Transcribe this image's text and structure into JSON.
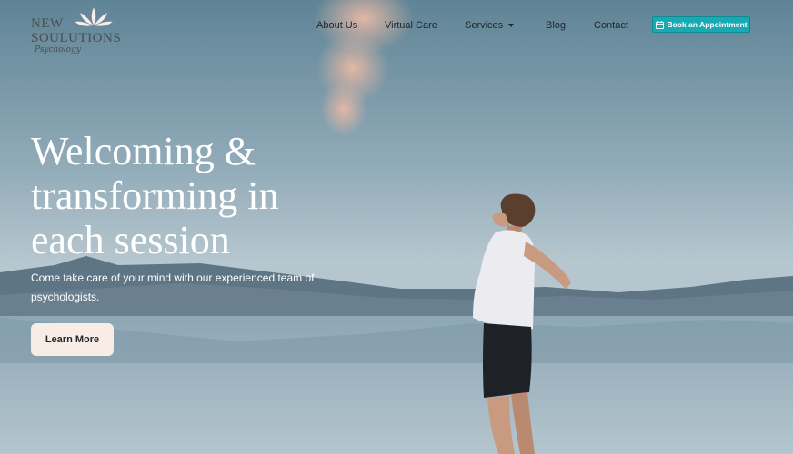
{
  "logo": {
    "line1": "NEW",
    "line2": "SOULUTIONS",
    "script": "Psychology"
  },
  "nav": {
    "items": [
      {
        "label": "About Us"
      },
      {
        "label": "Virtual Care"
      },
      {
        "label": "Services"
      },
      {
        "label": "Blog"
      },
      {
        "label": "Contact"
      }
    ],
    "cta_label": "Book an Appointment"
  },
  "hero": {
    "headline_lines": [
      "Welcoming &",
      "transforming in",
      "each session"
    ],
    "subtext": "Come take care of your mind with our experienced team of psychologists.",
    "button_label": "Learn More"
  },
  "colors": {
    "cta_background": "#17aab3",
    "button_background": "#f7ece6",
    "headline_text": "#ffffff",
    "nav_text": "#23272b"
  },
  "icons": {
    "calendar": "calendar-icon",
    "lotus": "lotus-logo-icon",
    "caret": "chevron-down-icon"
  }
}
